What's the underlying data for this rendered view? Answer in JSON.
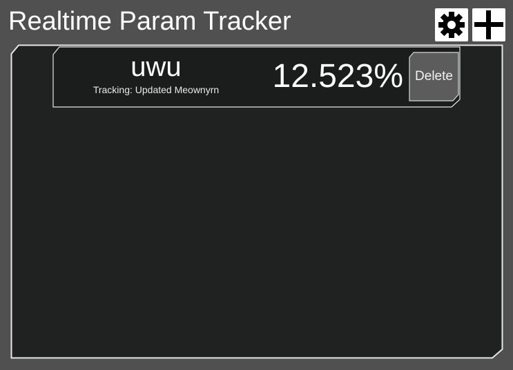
{
  "app": {
    "title": "Realtime Param Tracker"
  },
  "toolbar": {
    "settings_icon": "gear-icon",
    "add_icon": "plus-icon"
  },
  "trackers": [
    {
      "name": "uwu",
      "status": "Tracking: Updated Meownyrn",
      "value": "12.523%",
      "delete_label": "Delete"
    }
  ],
  "colors": {
    "background": "#505050",
    "panel": "#202222",
    "border": "#e6e6e6",
    "delete_button": "#5c5c5c",
    "text": "#ffffff"
  }
}
